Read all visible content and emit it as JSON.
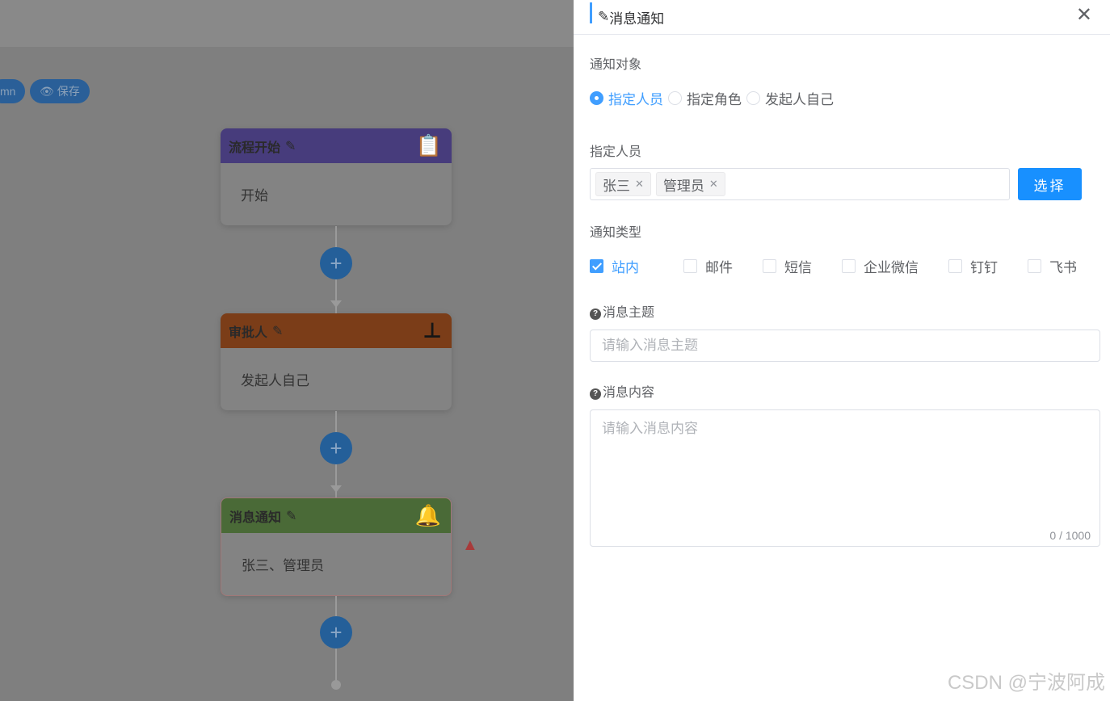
{
  "toolbar": {
    "bpmn_label": "mn",
    "save_label": "保存"
  },
  "flow": {
    "nodes": [
      {
        "title": "流程开始",
        "body": "开始",
        "color": "#473c7c"
      },
      {
        "title": "审批人",
        "body": "发起人自己",
        "color": "#7b3d18"
      },
      {
        "title": "消息通知",
        "body": "张三、管理员",
        "color": "#4a6a37"
      }
    ]
  },
  "panel": {
    "title": "消息通知",
    "target_label": "通知对象",
    "target_options": [
      "指定人员",
      "指定角色",
      "发起人自己"
    ],
    "target_selected": "指定人员",
    "assignee_label": "指定人员",
    "assignees": [
      "张三",
      "管理员"
    ],
    "select_button": "选择",
    "type_label": "通知类型",
    "types": [
      {
        "label": "站内",
        "checked": true
      },
      {
        "label": "邮件",
        "checked": false
      },
      {
        "label": "短信",
        "checked": false
      },
      {
        "label": "企业微信",
        "checked": false
      },
      {
        "label": "钉钉",
        "checked": false
      },
      {
        "label": "飞书",
        "checked": false
      }
    ],
    "subject_label": "消息主题",
    "subject_placeholder": "请输入消息主题",
    "content_label": "消息内容",
    "content_placeholder": "请输入消息内容",
    "content_count": "0 / 1000"
  },
  "watermark": "CSDN @宁波阿成"
}
